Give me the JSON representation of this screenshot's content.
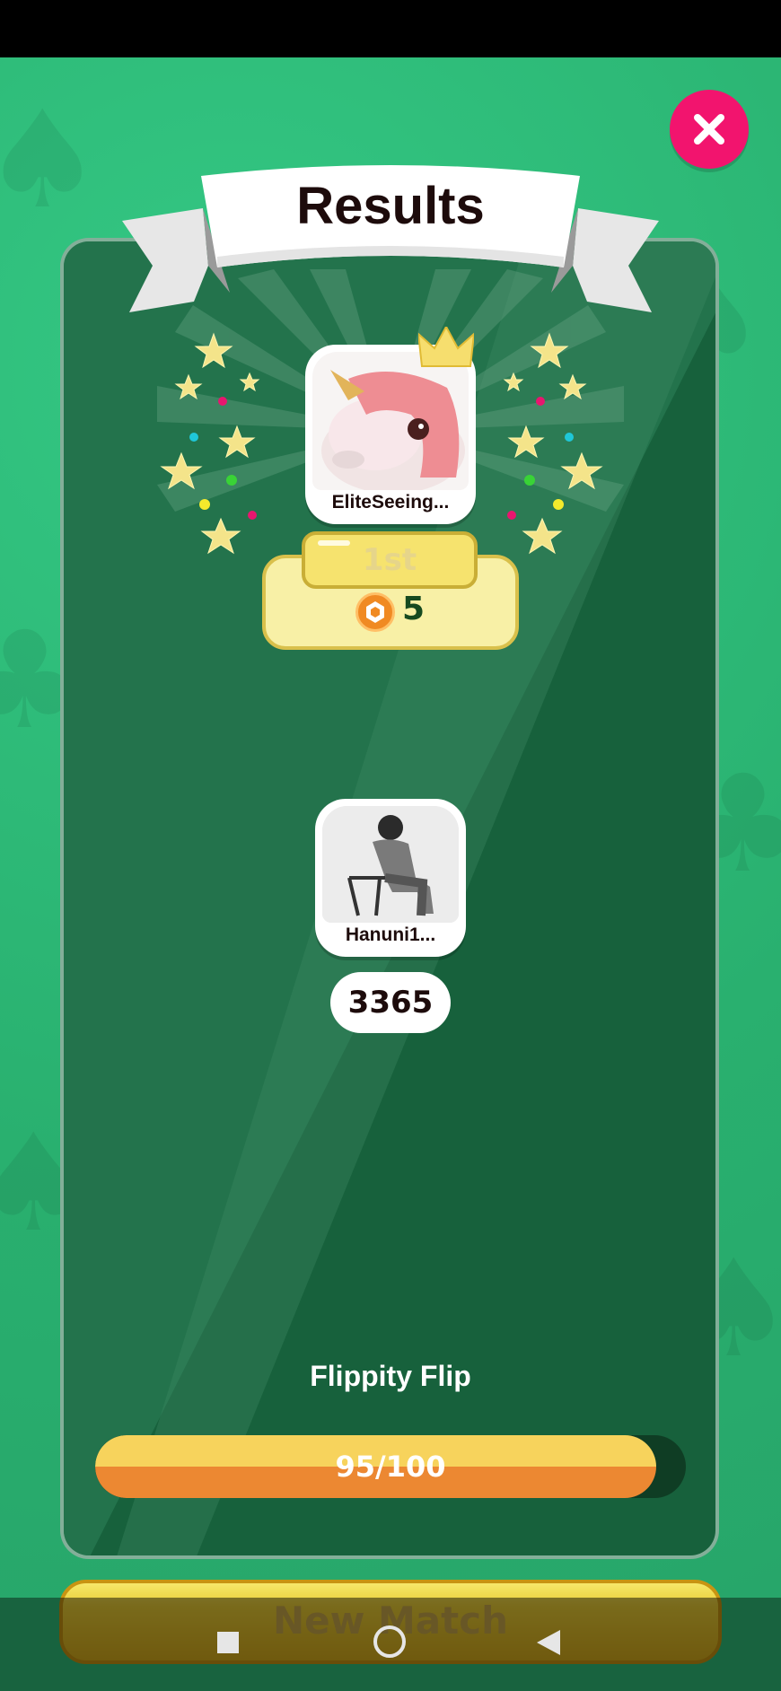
{
  "header": {
    "title": "Results"
  },
  "winner": {
    "username": "EliteSeeing...",
    "rank_label": "1st",
    "coins": "5"
  },
  "opponent": {
    "username": "Hanuni1...",
    "score": "3365"
  },
  "game": {
    "name": "Flippity Flip",
    "progress_text": "95/100",
    "progress_fraction": 0.95
  },
  "actions": {
    "new_match": "New Match"
  },
  "colors": {
    "background": "#2fbf7a",
    "panel": "#17613c",
    "close_button": "#f2146e",
    "progress_yellow": "#f7d35c",
    "progress_orange": "#ec8832",
    "button_gold": "#e9cc34"
  },
  "icons": {
    "close": "close-icon",
    "crown": "crown-icon",
    "coin": "coin-icon",
    "nav_recents": "square-icon",
    "nav_home": "circle-icon",
    "nav_back": "triangle-back-icon"
  }
}
